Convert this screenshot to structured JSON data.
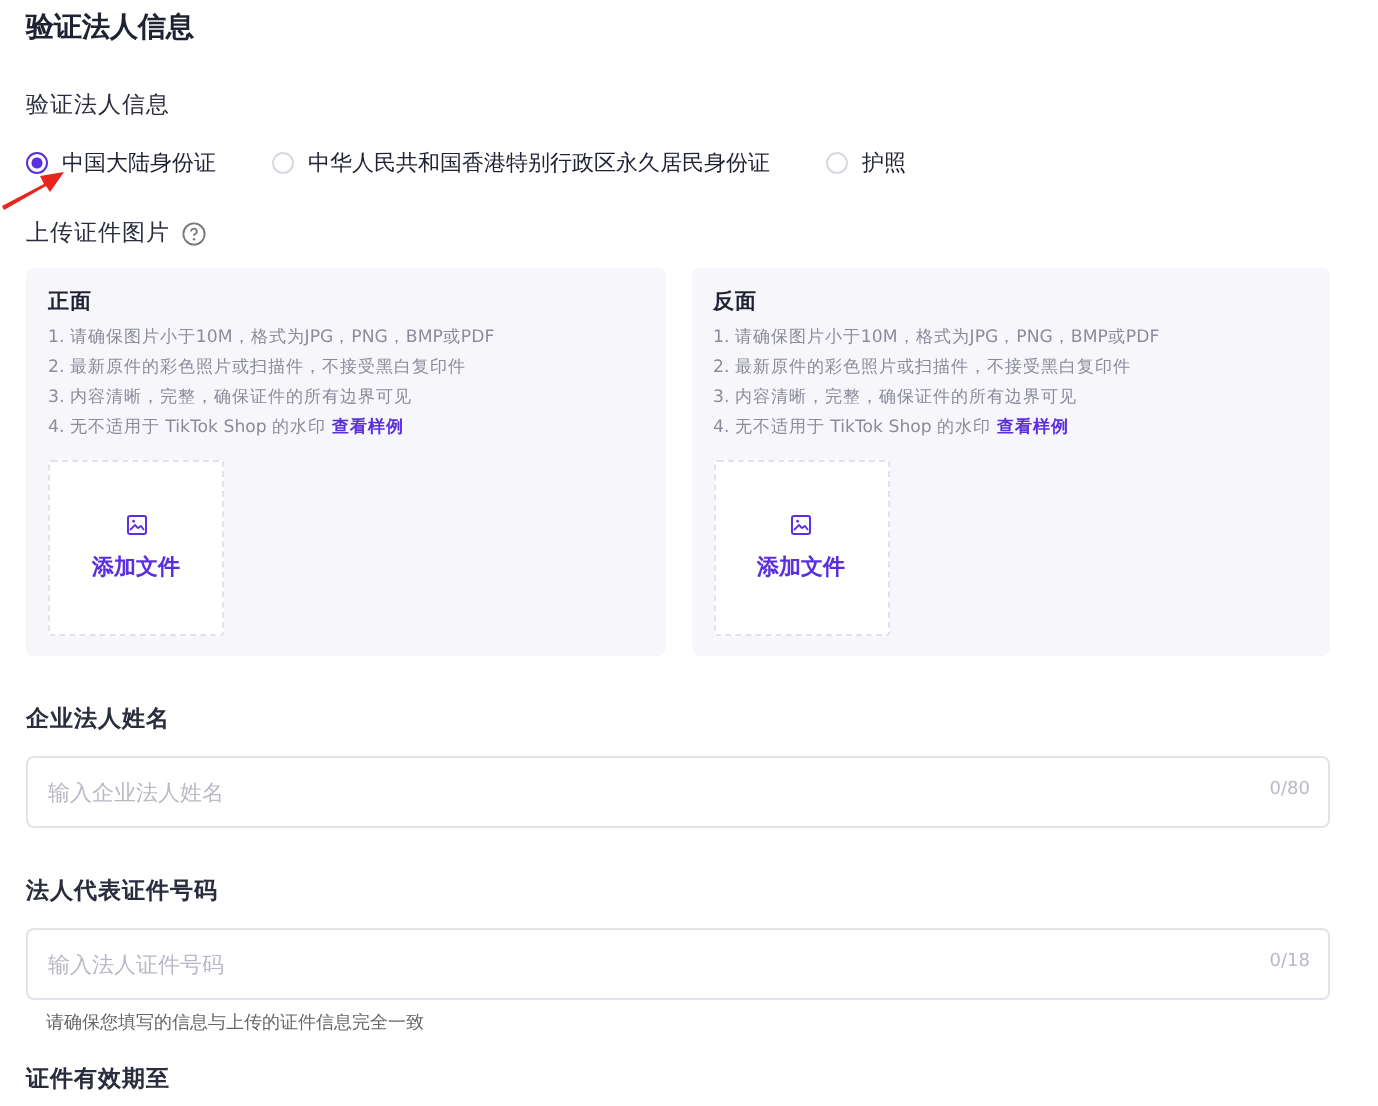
{
  "title": "验证法人信息",
  "id_type": {
    "label": "验证法人信息",
    "options": [
      {
        "label": "中国大陆身份证",
        "selected": true
      },
      {
        "label": "中华人民共和国香港特别行政区永久居民身份证",
        "selected": false
      },
      {
        "label": "护照",
        "selected": false
      }
    ]
  },
  "upload": {
    "label": "上传证件图片",
    "cards": [
      {
        "title": "正面",
        "rules": [
          "1. 请确保图片小于10M，格式为JPG，PNG，BMP或PDF",
          "2. 最新原件的彩色照片或扫描件，不接受黑白复印件",
          "3. 内容清晰，完整，确保证件的所有边界可见",
          "4. 无不适用于 TikTok Shop 的水印"
        ],
        "link": "查看样例",
        "button": "添加文件"
      },
      {
        "title": "反面",
        "rules": [
          "1. 请确保图片小于10M，格式为JPG，PNG，BMP或PDF",
          "2. 最新原件的彩色照片或扫描件，不接受黑白复印件",
          "3. 内容清晰，完整，确保证件的所有边界可见",
          "4. 无不适用于 TikTok Shop 的水印"
        ],
        "link": "查看样例",
        "button": "添加文件"
      }
    ]
  },
  "fields": [
    {
      "label": "企业法人姓名",
      "placeholder": "输入企业法人姓名",
      "counter": "0/80"
    },
    {
      "label": "法人代表证件号码",
      "placeholder": "输入法人证件号码",
      "counter": "0/18",
      "hint": "请确保您填写的信息与上传的证件信息完全一致"
    }
  ],
  "next_label": "证件有效期至"
}
